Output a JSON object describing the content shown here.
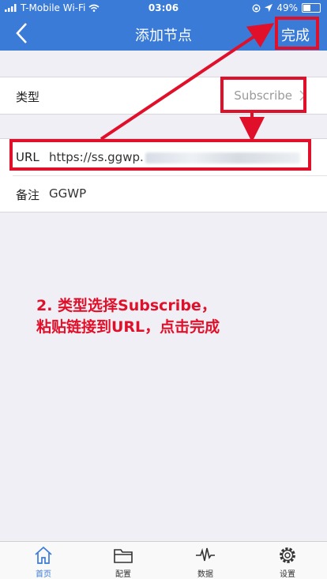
{
  "status": {
    "carrier": "T-Mobile Wi-Fi",
    "time": "03:06",
    "battery": "49%"
  },
  "nav": {
    "title": "添加节点",
    "done": "完成"
  },
  "form": {
    "type_label": "类型",
    "type_value": "Subscribe",
    "url_label": "URL",
    "url_value": "https://ss.ggwp.",
    "note_label": "备注",
    "note_value": "GGWP"
  },
  "annotation": {
    "line1": "2. 类型选择Subscribe，",
    "line2": "粘贴链接到URL，点击完成",
    "color": "#e0102a"
  },
  "tabs": [
    {
      "label": "首页",
      "icon": "home-icon"
    },
    {
      "label": "配置",
      "icon": "folder-icon"
    },
    {
      "label": "数据",
      "icon": "pulse-icon"
    },
    {
      "label": "设置",
      "icon": "gear-icon"
    }
  ],
  "colors": {
    "primary": "#3b7bd8",
    "background": "#f0eff5"
  }
}
